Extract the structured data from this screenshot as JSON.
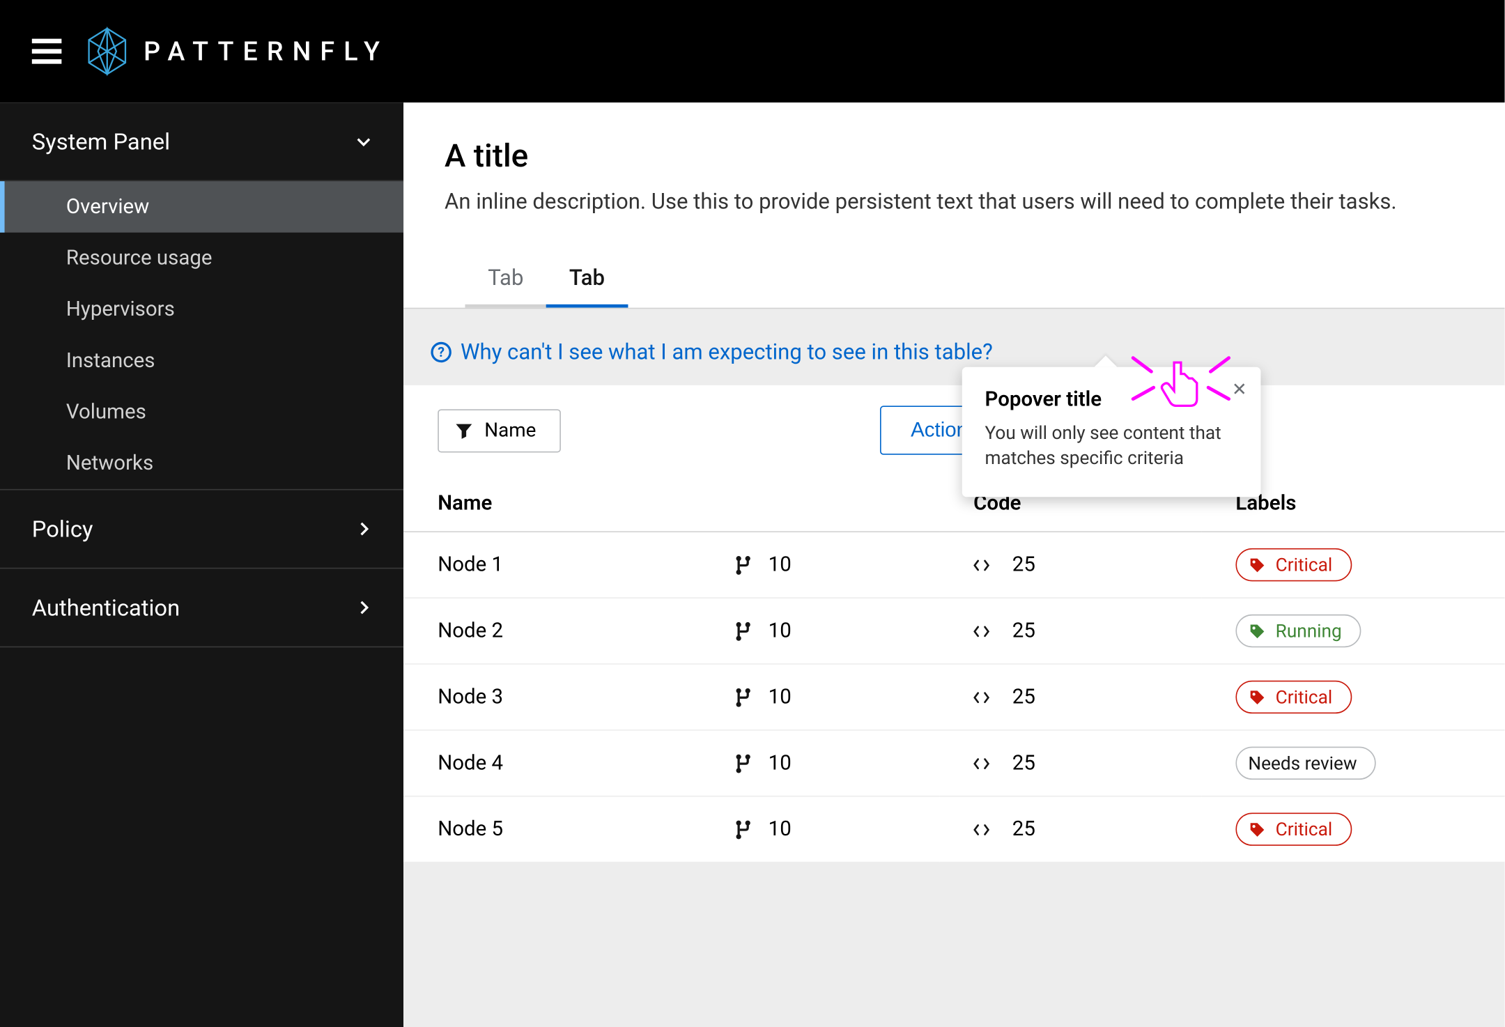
{
  "brand": "PATTERNFLY",
  "sidebar": {
    "sections": [
      {
        "title": "System Panel",
        "expanded": true,
        "items": [
          "Overview",
          "Resource usage",
          "Hypervisors",
          "Instances",
          "Volumes",
          "Networks"
        ],
        "active_index": 0
      },
      {
        "title": "Policy",
        "expanded": false
      },
      {
        "title": "Authentication",
        "expanded": false
      }
    ]
  },
  "page": {
    "title": "A title",
    "description": "An inline description. Use this to provide persistent text that users will need to complete their tasks.",
    "tabs": [
      "Tab",
      "Tab"
    ],
    "active_tab": 1
  },
  "hint_text": "Why can't I see what I am expecting to see in this table?",
  "toolbar": {
    "filter_label": "Name",
    "action_label": "Action"
  },
  "popover": {
    "title": "Popover title",
    "body": "You will only see content that matches specific criteria"
  },
  "table": {
    "columns": [
      "Name",
      "",
      "Code",
      "Labels"
    ],
    "rows": [
      {
        "name": "Node 1",
        "branch": "10",
        "code": "25",
        "label": {
          "text": "Critical",
          "variant": "critical"
        }
      },
      {
        "name": "Node 2",
        "branch": "10",
        "code": "25",
        "label": {
          "text": "Running",
          "variant": "running"
        }
      },
      {
        "name": "Node 3",
        "branch": "10",
        "code": "25",
        "label": {
          "text": "Critical",
          "variant": "critical"
        }
      },
      {
        "name": "Node 4",
        "branch": "10",
        "code": "25",
        "label": {
          "text": "Needs review",
          "variant": "review"
        }
      },
      {
        "name": "Node 5",
        "branch": "10",
        "code": "25",
        "label": {
          "text": "Critical",
          "variant": "critical"
        }
      }
    ]
  }
}
